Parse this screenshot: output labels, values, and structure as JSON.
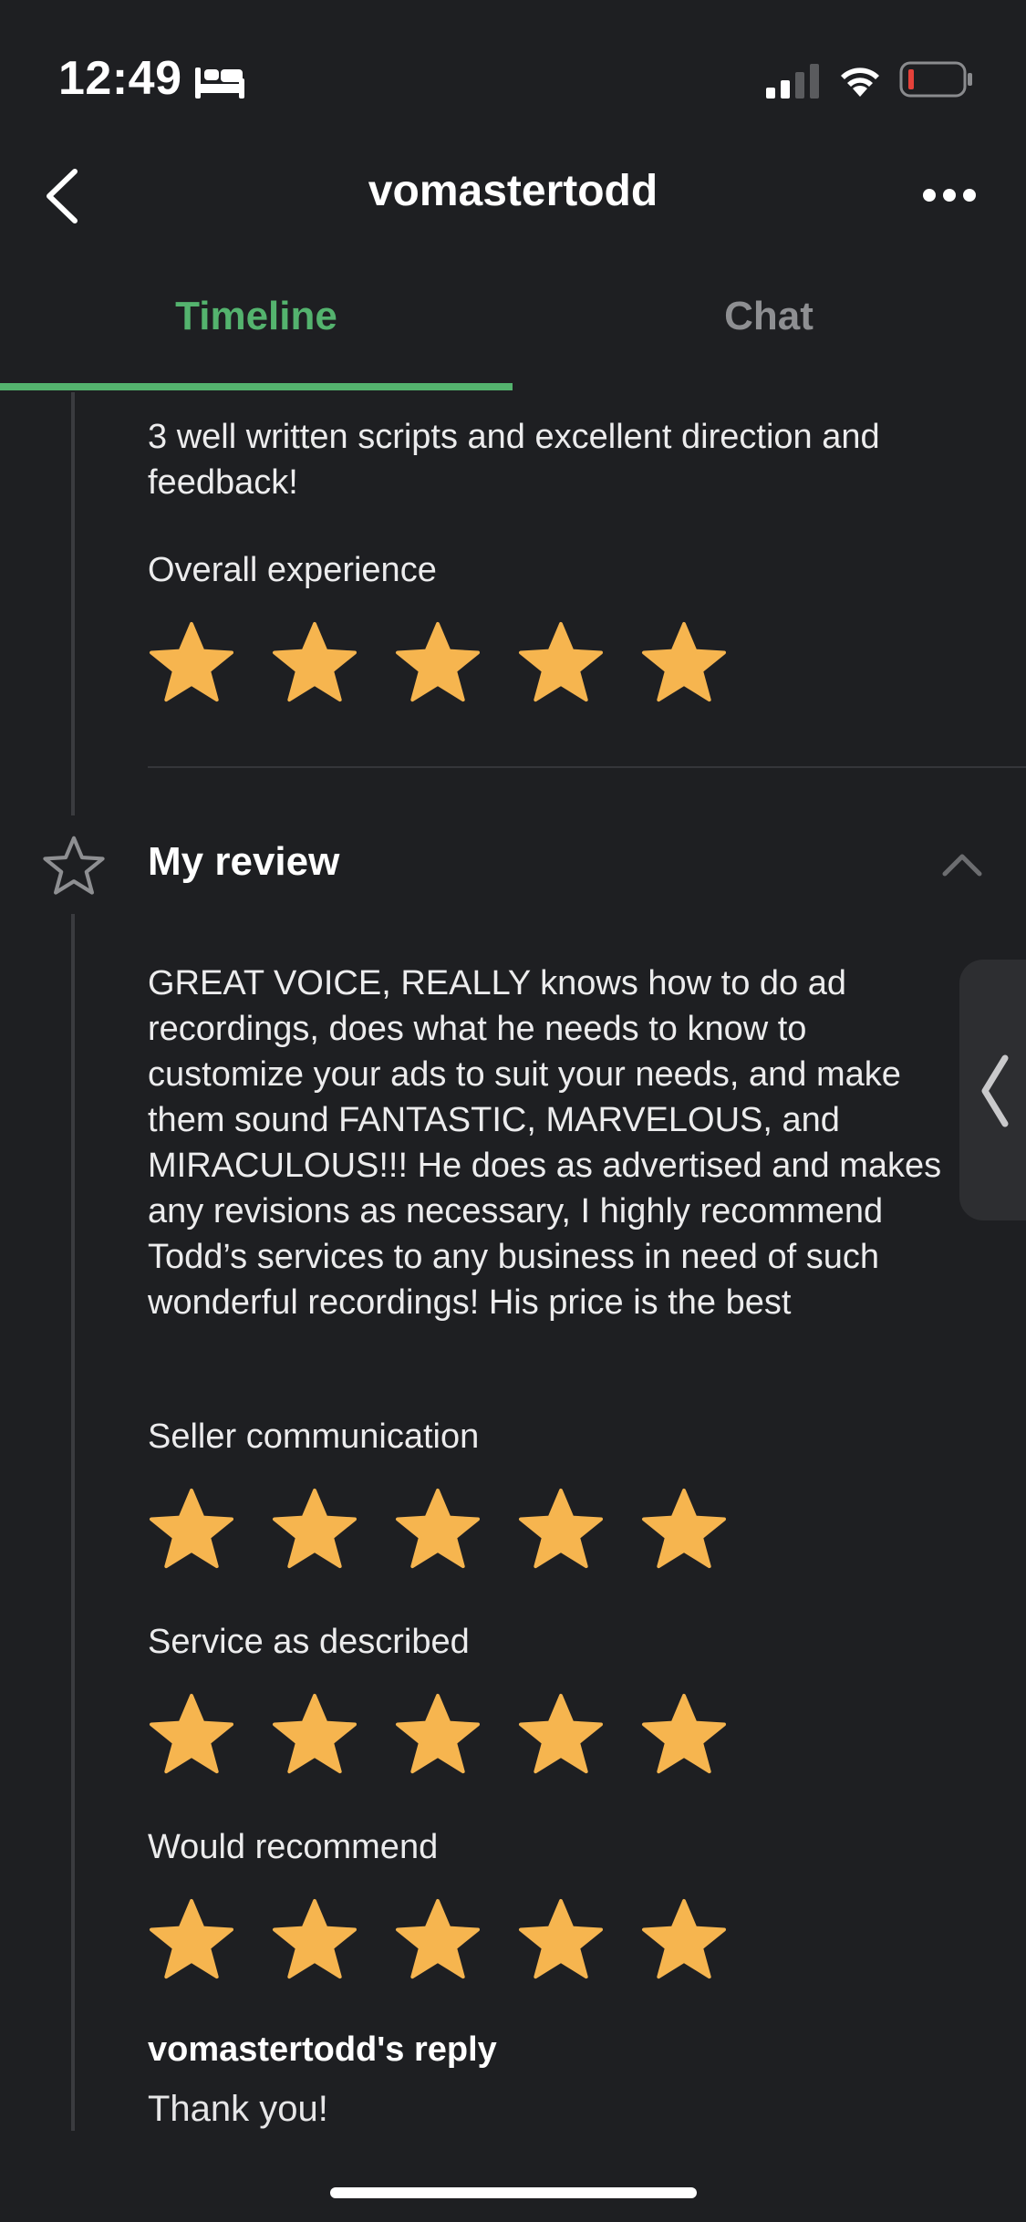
{
  "status_bar": {
    "time": "12:49"
  },
  "header": {
    "title": "vomastertodd"
  },
  "tabs": [
    {
      "label": "Timeline",
      "active": true
    },
    {
      "label": "Chat",
      "active": false
    }
  ],
  "prior_review": {
    "text": "3 well written scripts and excellent direction and feedback!",
    "rating_label": "Overall experience",
    "rating": 5
  },
  "my_review": {
    "title": "My review",
    "text": "GREAT VOICE, REALLY knows how to do ad recordings, does what he needs to know to customize your ads to suit your needs, and make them sound FANTASTIC, MARVELOUS, and MIRACULOUS!!! He does as advertised and makes any revisions as necessary, I highly recommend Todd’s services to any business in need of such wonderful recordings! His price is the best",
    "ratings": [
      {
        "label": "Seller communication",
        "value": 5
      },
      {
        "label": "Service as described",
        "value": 5
      },
      {
        "label": "Would recommend",
        "value": 5
      }
    ],
    "reply": {
      "title": "vomastertodd's reply",
      "text": "Thank you!"
    }
  },
  "colors": {
    "accent": "#54b36e",
    "star": "#f6b54f",
    "background": "#1e1f22"
  }
}
